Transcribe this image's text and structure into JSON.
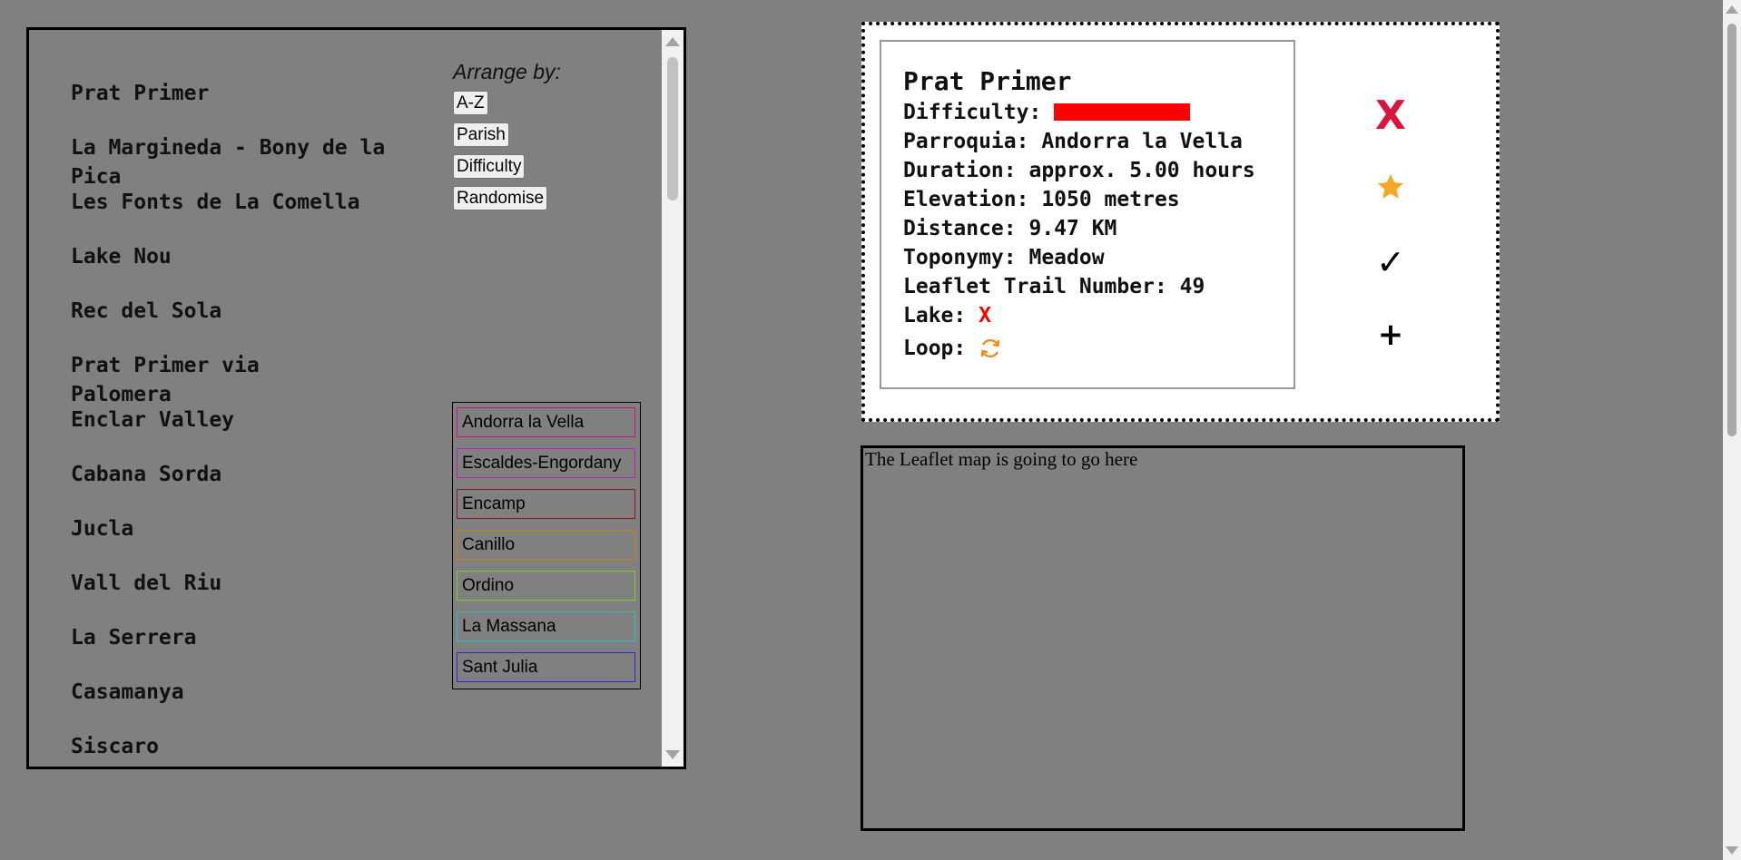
{
  "trails": [
    "Prat Primer",
    "La Margineda - Bony de la Pica",
    "Les Fonts de La Comella",
    "Lake Nou",
    "Rec del Sola",
    "Prat Primer via Palomera",
    "Enclar Valley",
    "Cabana Sorda",
    "Jucla",
    "Vall del Riu",
    "La Serrera",
    "Casamanya",
    "Siscaro"
  ],
  "sort": {
    "label": "Arrange by:",
    "options": [
      "A-Z",
      "Parish",
      "Difficulty",
      "Randomise"
    ]
  },
  "parishes": [
    {
      "name": "Andorra la Vella",
      "color": "#c71585"
    },
    {
      "name": "Escaldes-Engordany",
      "color": "#b02ab0"
    },
    {
      "name": "Encamp",
      "color": "#8b1a1a"
    },
    {
      "name": "Canillo",
      "color": "#cd7f1a"
    },
    {
      "name": "Ordino",
      "color": "#7ccd32"
    },
    {
      "name": "La Massana",
      "color": "#2ac0c0"
    },
    {
      "name": "Sant Julia",
      "color": "#2a2acd"
    }
  ],
  "card": {
    "title": "Prat Primer",
    "difficulty_label": "Difficulty:",
    "difficulty_color": "#ff0000",
    "parroquia": "Parroquia: Andorra la Vella",
    "duration": "Duration: approx. 5.00 hours",
    "elevation": "Elevation: 1050 metres",
    "distance": "Distance: 9.47 KM",
    "toponymy": "Toponymy: Meadow",
    "leaflet": "Leaflet Trail Number: 49",
    "lake_label": "Lake:",
    "lake_value": "X",
    "loop_label": "Loop:",
    "loop_icon": "refresh-icon",
    "actions": {
      "dismiss": "X",
      "favorite_icon": "star-icon",
      "done": "✓",
      "add": "+"
    }
  },
  "map_placeholder": "The Leaflet map is going to go here"
}
